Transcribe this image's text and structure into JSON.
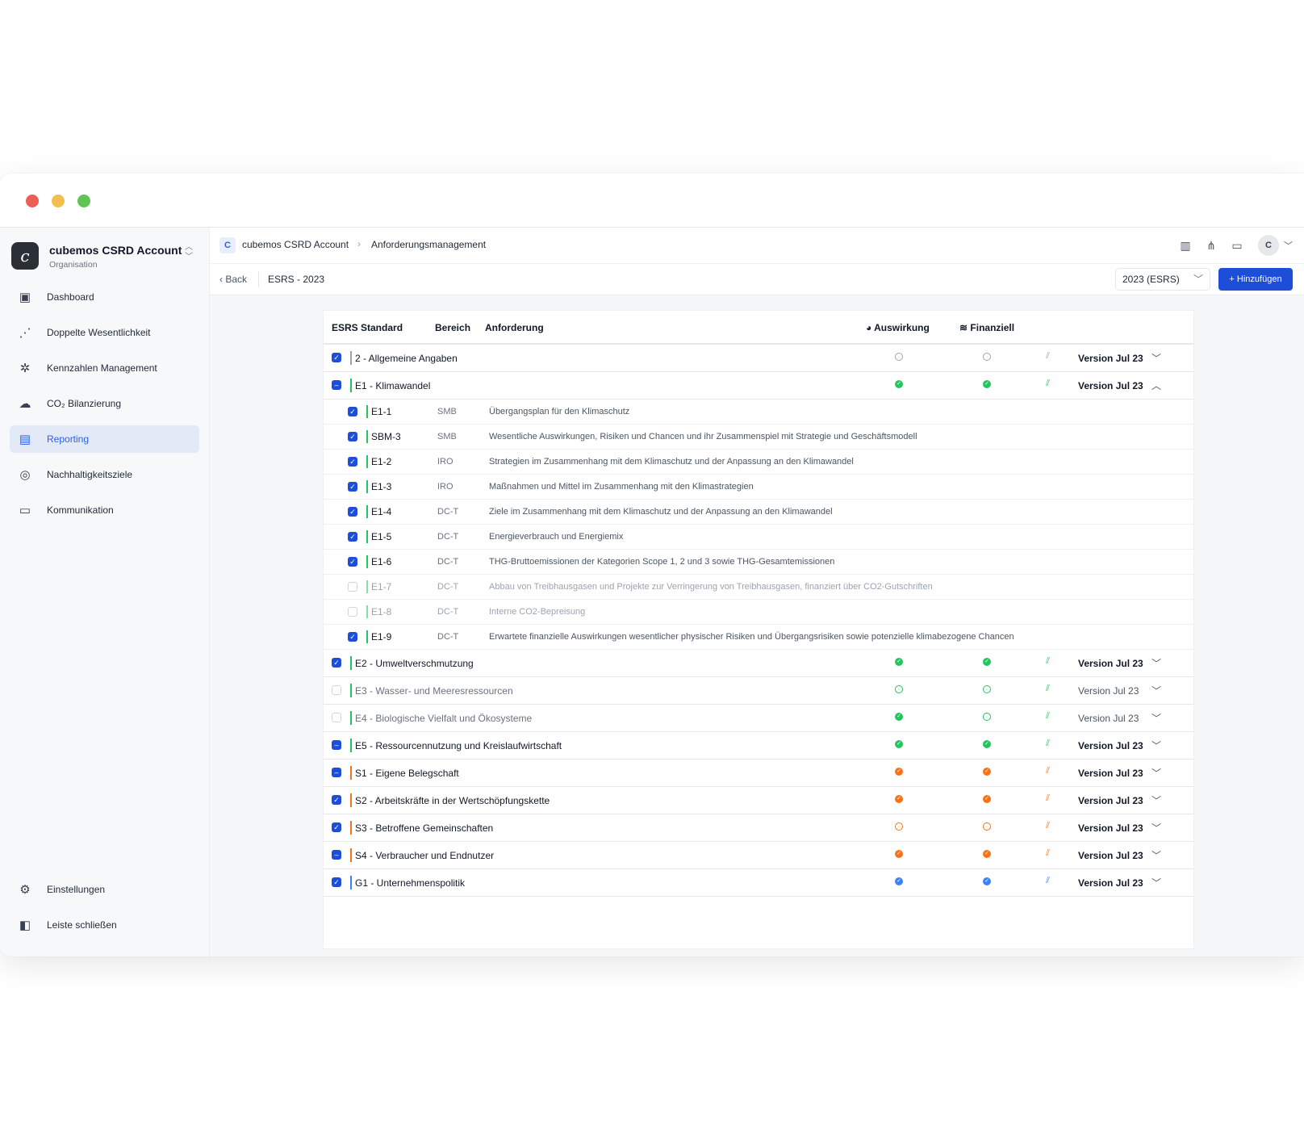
{
  "org": {
    "name": "cubemos CSRD Account",
    "sub": "Organisation",
    "logo": "c"
  },
  "nav": [
    {
      "label": "Dashboard",
      "icon": "layout-icon",
      "glyph": "▣"
    },
    {
      "label": "Doppelte Wesentlichkeit",
      "icon": "scatter-chart-icon",
      "glyph": "⋰"
    },
    {
      "label": "Kennzahlen Management",
      "icon": "network-icon",
      "glyph": "✲"
    },
    {
      "label": "CO₂ Bilanzierung",
      "icon": "cloud-icon",
      "glyph": "☁"
    },
    {
      "label": "Reporting",
      "icon": "document-icon",
      "glyph": "▤",
      "active": true
    },
    {
      "label": "Nachhaltigkeitsziele",
      "icon": "target-icon",
      "glyph": "◎"
    },
    {
      "label": "Kommunikation",
      "icon": "presentation-icon",
      "glyph": "▭"
    }
  ],
  "nav_bottom": [
    {
      "label": "Einstellungen",
      "icon": "gear-icon",
      "glyph": "⚙"
    },
    {
      "label": "Leiste schließen",
      "icon": "sidebar-toggle-icon",
      "glyph": "◧"
    }
  ],
  "breadcrumb": {
    "logo": "C",
    "root": "cubemos CSRD Account",
    "current": "Anforderungsmanagement"
  },
  "topbar": {
    "avatar": "C"
  },
  "subbar": {
    "back": "Back",
    "title": "ESRS - 2023",
    "year_select": "2023 (ESRS)",
    "add_button": "Hinzufügen"
  },
  "table": {
    "headers": {
      "standard": "ESRS Standard",
      "bereich": "Bereich",
      "anforderung": "Anforderung",
      "auswirkung": "Auswirkung",
      "finanziell": "Finanziell"
    },
    "colors": {
      "green": "#22c55e",
      "orange": "#f97316",
      "blue": "#3b82f6",
      "gray": "#9ca3af"
    },
    "groups": [
      {
        "label": "2 - Allgemeine Angaben",
        "checkbox": "checked",
        "color": "gray",
        "impact": "outline",
        "financial": "outline",
        "version": "Version Jul 23",
        "expanded": false
      },
      {
        "label": "E1 - Klimawandel",
        "checkbox": "partial",
        "color": "green",
        "impact": "filled",
        "financial": "filled",
        "version": "Version Jul 23",
        "expanded": true,
        "children": [
          {
            "code": "E1-1",
            "bereich": "SMB",
            "text": "Übergangsplan für den Klimaschutz",
            "checked": true
          },
          {
            "code": "SBM-3",
            "bereich": "SMB",
            "text": "Wesentliche Auswirkungen, Risiken und Chancen und ihr Zusammenspiel mit Strategie und Geschäftsmodell",
            "checked": true
          },
          {
            "code": "E1-2",
            "bereich": "IRO",
            "text": "Strategien im Zusammenhang mit dem Klimaschutz und der Anpassung an den Klimawandel",
            "checked": true
          },
          {
            "code": "E1-3",
            "bereich": "IRO",
            "text": "Maßnahmen und Mittel im Zusammenhang mit den Klimastrategien",
            "checked": true
          },
          {
            "code": "E1-4",
            "bereich": "DC-T",
            "text": "Ziele im Zusammenhang mit dem Klimaschutz und der Anpassung an den Klimawandel",
            "checked": true
          },
          {
            "code": "E1-5",
            "bereich": "DC-T",
            "text": "Energieverbrauch und Energiemix",
            "checked": true
          },
          {
            "code": "E1-6",
            "bereich": "DC-T",
            "text": "THG-Bruttoemissionen der Kategorien Scope 1, 2 und 3 sowie THG-Gesamtemissionen",
            "checked": true
          },
          {
            "code": "E1-7",
            "bereich": "DC-T",
            "text": "Abbau von Treibhausgasen und Projekte zur Verringerung von Treibhausgasen, finanziert über CO2-Gutschriften",
            "checked": false
          },
          {
            "code": "E1-8",
            "bereich": "DC-T",
            "text": "Interne CO2-Bepreisung",
            "checked": false
          },
          {
            "code": "E1-9",
            "bereich": "DC-T",
            "text": "Erwartete finanzielle Auswirkungen wesentlicher physischer Risiken und Übergangsrisiken sowie potenzielle klimabezogene Chancen",
            "checked": true
          }
        ]
      },
      {
        "label": "E2 - Umweltverschmutzung",
        "checkbox": "checked",
        "color": "green",
        "impact": "filled",
        "financial": "filled",
        "version": "Version Jul 23"
      },
      {
        "label": "E3 - Wasser- und Meeresressourcen",
        "checkbox": "empty",
        "color": "green",
        "impact": "outline",
        "financial": "outline",
        "version": "Version Jul 23"
      },
      {
        "label": "E4 - Biologische Vielfalt und Ökosysteme",
        "checkbox": "empty",
        "color": "green",
        "impact": "filled",
        "financial": "outline",
        "version": "Version Jul 23"
      },
      {
        "label": "E5 - Ressourcennutzung und Kreislaufwirtschaft",
        "checkbox": "partial",
        "color": "green",
        "impact": "filled",
        "financial": "filled",
        "version": "Version Jul 23"
      },
      {
        "label": "S1 - Eigene Belegschaft",
        "checkbox": "partial",
        "color": "orange",
        "impact": "filled",
        "financial": "filled",
        "version": "Version Jul 23"
      },
      {
        "label": "S2 - Arbeitskräfte in der Wertschöpfungskette",
        "checkbox": "checked",
        "color": "orange",
        "impact": "filled",
        "financial": "filled",
        "version": "Version Jul 23"
      },
      {
        "label": "S3 - Betroffene Gemeinschaften",
        "checkbox": "checked",
        "color": "orange",
        "impact": "outline",
        "financial": "outline",
        "version": "Version Jul 23"
      },
      {
        "label": "S4 - Verbraucher und Endnutzer",
        "checkbox": "partial",
        "color": "orange",
        "impact": "filled",
        "financial": "filled",
        "version": "Version Jul 23"
      },
      {
        "label": "G1 - Unternehmenspolitik",
        "checkbox": "checked",
        "color": "blue",
        "impact": "filled",
        "financial": "filled",
        "version": "Version Jul 23"
      }
    ]
  }
}
